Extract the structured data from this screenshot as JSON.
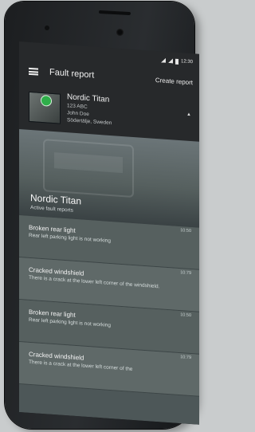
{
  "status": {
    "time": "12:30"
  },
  "appbar": {
    "title": "Fault report",
    "action": "Create report"
  },
  "vehicle": {
    "name": "Nordic Titan",
    "lines": [
      "123 ABC",
      "John Doe",
      "Södertälje, Sweden"
    ],
    "badge_color": "#2fae4a"
  },
  "hero": {
    "title": "Nordic Titan",
    "subtitle": "Active fault reports"
  },
  "items": [
    {
      "title": "Broken rear light",
      "desc": "Rear left parking light is not working",
      "time": "10:50"
    },
    {
      "title": "Cracked windshield",
      "desc": "There is a crack at the lower left corner of the windshield.",
      "time": "10:79"
    },
    {
      "title": "Broken rear light",
      "desc": "Rear left parking light is not working",
      "time": "10:50"
    },
    {
      "title": "Cracked windshield",
      "desc": "There is a crack at the lower left corner of the",
      "time": "10:79"
    }
  ]
}
